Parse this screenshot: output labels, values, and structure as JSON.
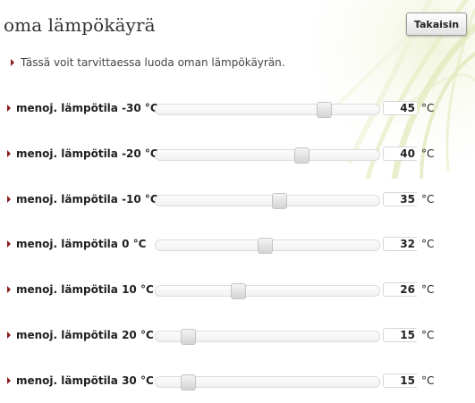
{
  "header": {
    "title": "oma lämpökäyrä",
    "back_button": "Takaisin"
  },
  "intro_text": "Tässä voit tarvittaessa luoda oman lämpökäyrän.",
  "slider_range": {
    "min": 15,
    "max": 55
  },
  "rows": [
    {
      "label": "menoj. lämpötila -30 °C",
      "value": "45",
      "unit": "°C"
    },
    {
      "label": "menoj. lämpötila -20 °C",
      "value": "40",
      "unit": "°C"
    },
    {
      "label": "menoj. lämpötila -10 °C",
      "value": "35",
      "unit": "°C"
    },
    {
      "label": "menoj. lämpötila 0 °C",
      "value": "32",
      "unit": "°C"
    },
    {
      "label": "menoj. lämpötila 10 °C",
      "value": "26",
      "unit": "°C"
    },
    {
      "label": "menoj. lämpötila 20 °C",
      "value": "15",
      "unit": "°C"
    },
    {
      "label": "menoj. lämpötila 30 °C",
      "value": "15",
      "unit": "°C"
    }
  ],
  "colors": {
    "accent_arrow": "#8b1a1a"
  },
  "icons": {
    "bullet": "triangle-right-icon",
    "backdrop": "grass-decoration"
  }
}
